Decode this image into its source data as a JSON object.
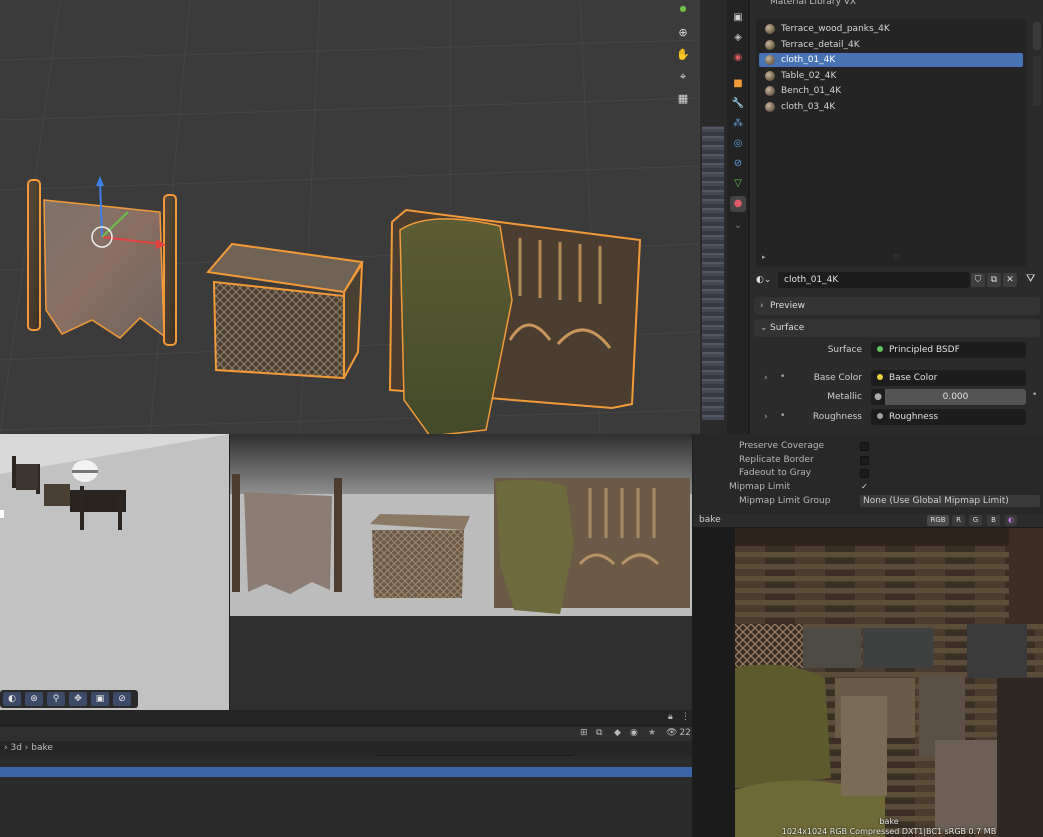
{
  "blender": {
    "panel_title": "Material Library VX",
    "materials": [
      {
        "name": "Terrace_wood_panks_4K",
        "selected": false
      },
      {
        "name": "Terrace_detail_4K",
        "selected": false
      },
      {
        "name": "cloth_01_4K",
        "selected": true
      },
      {
        "name": "Table_02_4K",
        "selected": false
      },
      {
        "name": "Bench_01_4K",
        "selected": false
      },
      {
        "name": "cloth_03_4K",
        "selected": false
      }
    ],
    "material_field_value": "cloth_01_4K",
    "preview_label": "Preview",
    "surface_label": "Surface",
    "surface_prop_label": "Surface",
    "surface_shader": "Principled BSDF",
    "base_color_label": "Base Color",
    "base_color_value": "Base Color",
    "metallic_label": "Metallic",
    "metallic_value": "0.000",
    "roughness_label": "Roughness",
    "roughness_value": "Roughness",
    "selection_color": "#4772b3",
    "outline_color": "#f29a3a"
  },
  "unity": {
    "inspector": {
      "rows": [
        {
          "label": "Preserve Coverage",
          "checked": false
        },
        {
          "label": "Replicate Border",
          "checked": false
        },
        {
          "label": "Fadeout to Gray",
          "checked": false
        },
        {
          "label": "Mipmap Limit",
          "checked": true
        }
      ],
      "mip_group_label": "Mipmap Limit Group",
      "mip_group_value": "None (Use Global Mipmap Limit)"
    },
    "preview": {
      "title": "bake",
      "channels": [
        "RGB",
        "R",
        "G",
        "B"
      ],
      "texture_name": "bake",
      "texture_info": "1024x1024  RGB Compressed DXT1|BC1 sRGB  0.7 MB"
    },
    "breadcrumb": [
      "3d",
      "bake"
    ],
    "visible_count": "22"
  }
}
